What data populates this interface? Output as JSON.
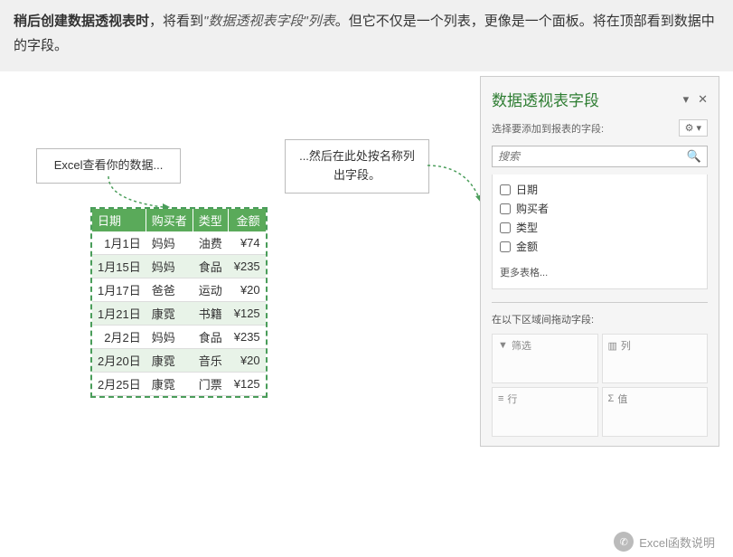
{
  "top": {
    "bold": "稍后创建数据透视表时",
    "part1": "，将看到",
    "italic": "\"数据透视表字段\"列表",
    "part2": "。但它不仅是一个列表，更像是一个面板。将在顶部看到数据中的字段。"
  },
  "callouts": {
    "c1": "Excel查看你的数据...",
    "c2": "...然后在此处按名称列出字段。"
  },
  "table": {
    "headers": [
      "日期",
      "购买者",
      "类型",
      "金额"
    ],
    "rows": [
      [
        "1月1日",
        "妈妈",
        "油费",
        "¥74"
      ],
      [
        "1月15日",
        "妈妈",
        "食品",
        "¥235"
      ],
      [
        "1月17日",
        "爸爸",
        "运动",
        "¥20"
      ],
      [
        "1月21日",
        "康霓",
        "书籍",
        "¥125"
      ],
      [
        "2月2日",
        "妈妈",
        "食品",
        "¥235"
      ],
      [
        "2月20日",
        "康霓",
        "音乐",
        "¥20"
      ],
      [
        "2月25日",
        "康霓",
        "门票",
        "¥125"
      ]
    ]
  },
  "pivot": {
    "title": "数据透视表字段",
    "subtitle": "选择要添加到报表的字段:",
    "search_placeholder": "搜索",
    "fields": [
      "日期",
      "购买者",
      "类型",
      "金额"
    ],
    "more_tables": "更多表格...",
    "drag_label": "在以下区域间拖动字段:",
    "zones": {
      "filter": "筛选",
      "columns": "列",
      "rows": "行",
      "values": "值"
    }
  },
  "footer": "Excel函数说明"
}
